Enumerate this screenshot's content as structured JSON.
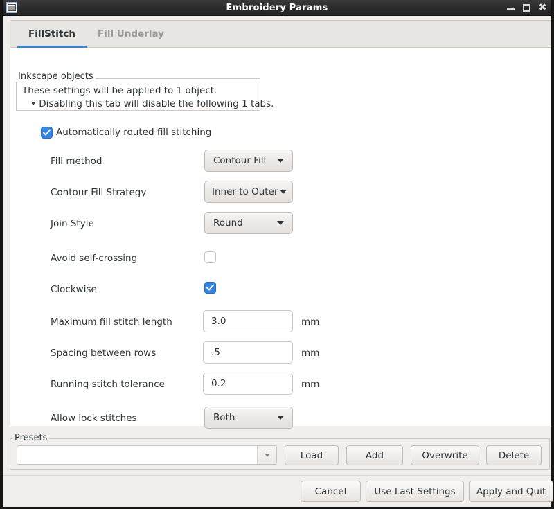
{
  "window": {
    "title": "Embroidery Params",
    "icon": "embroidery-app-icon",
    "controls": {
      "minimize": "minimize-icon",
      "maximize": "maximize-icon",
      "close": "✖"
    }
  },
  "tabs": [
    {
      "label": "FillStitch",
      "active": true
    },
    {
      "label": "Fill Underlay",
      "active": false
    }
  ],
  "inkscape_objects": {
    "legend": "Inkscape objects",
    "line1": "These settings will be applied to 1 object.",
    "line2": "• Disabling this tab will disable the following 1 tabs."
  },
  "auto_route": {
    "label": "Automatically routed fill stitching",
    "checked": true
  },
  "fields": [
    {
      "type": "combo",
      "label": "Fill method",
      "value": "Contour Fill"
    },
    {
      "type": "combo",
      "label": "Contour Fill Strategy",
      "value": "Inner to Outer"
    },
    {
      "type": "combo",
      "label": "Join Style",
      "value": "Round"
    },
    {
      "type": "checkbox",
      "label": "Avoid self-crossing",
      "checked": false
    },
    {
      "type": "checkbox",
      "label": "Clockwise",
      "checked": true
    },
    {
      "type": "entry",
      "label": "Maximum fill stitch length",
      "value": "3.0",
      "unit": "mm"
    },
    {
      "type": "entry",
      "label": "Spacing between rows",
      "value": ".5",
      "unit": "mm"
    },
    {
      "type": "entry",
      "label": "Running stitch tolerance",
      "value": "0.2",
      "unit": "mm"
    },
    {
      "type": "combo",
      "label": "Allow lock stitches",
      "value": "Both"
    }
  ],
  "presets": {
    "legend": "Presets",
    "combo_value": "",
    "combo_placeholder": "",
    "buttons": [
      {
        "label": "Load"
      },
      {
        "label": "Add"
      },
      {
        "label": "Overwrite"
      },
      {
        "label": "Delete"
      }
    ]
  },
  "actions": [
    {
      "label": "Cancel"
    },
    {
      "label": "Use Last Settings"
    },
    {
      "label": "Apply and Quit"
    }
  ],
  "colors": {
    "accent": "#3584e4",
    "titlebar": "#2b2b2b",
    "panel": "#f0efee",
    "content": "#ffffff",
    "border": "#cdc7c2"
  }
}
